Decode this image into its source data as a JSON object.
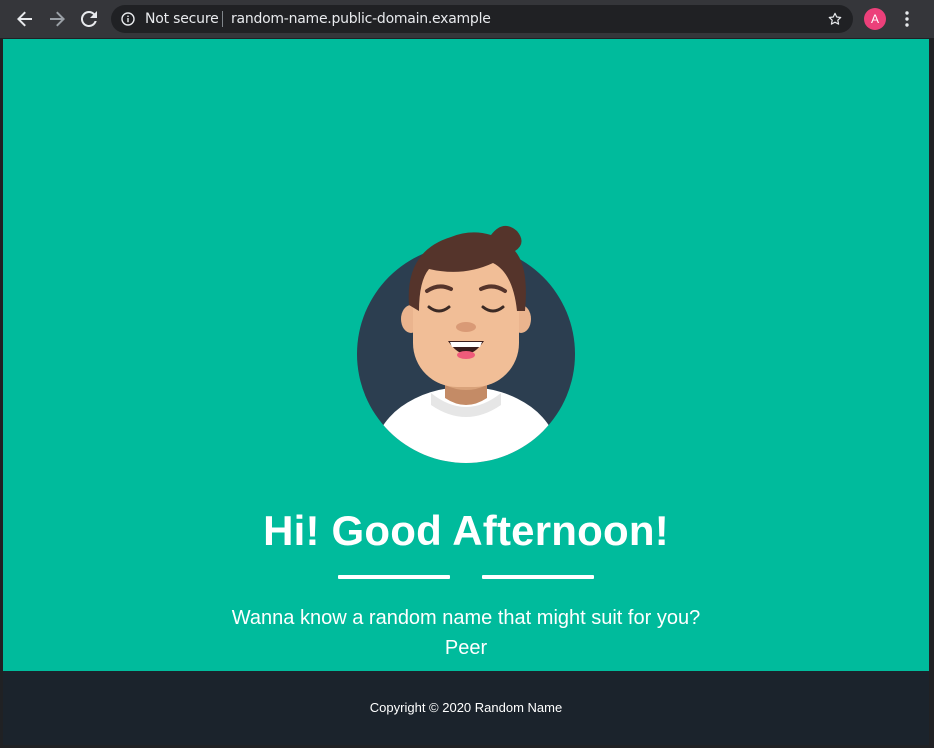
{
  "browser": {
    "security_label": "Not secure",
    "url": "random-name.public-domain.example",
    "profile_initial": "A",
    "icons": [
      "back-arrow-icon",
      "forward-arrow-icon",
      "reload-icon",
      "info-icon",
      "star-icon",
      "more-vert-icon"
    ],
    "colors": {
      "toolbar": "#35363a",
      "omnibox": "#202124",
      "profile": "#ec407a"
    }
  },
  "page": {
    "greeting": "Hi! Good Afternoon!",
    "question": "Wanna know a random name that might suit for you?",
    "name": "Peer",
    "illustration": "smiling-person-avatar",
    "colors": {
      "hero_bg": "#00bb9c",
      "footer_bg": "#1b232c",
      "text": "#ffffff"
    }
  },
  "footer": {
    "copyright": "Copyright © 2020 Random Name"
  }
}
